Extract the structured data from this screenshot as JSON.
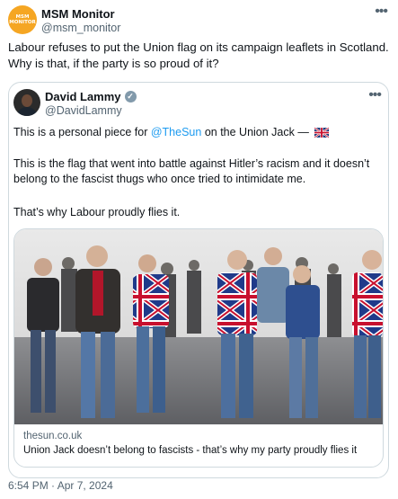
{
  "tweet": {
    "avatar_text": [
      "MSM",
      "MONITOR"
    ],
    "display_name": "MSM Monitor",
    "handle": "@msm_monitor",
    "more_icon": "more-horizontal-icon",
    "text": "Labour refuses to put the Union flag on its campaign leaflets in Scotland. Why is that, if the party is so proud of it?",
    "timestamp": "6:54 PM · Apr 7, 2024"
  },
  "quoted": {
    "display_name": "David Lammy",
    "handle": "@DavidLammy",
    "verified_icon": "verified-badge-icon",
    "line1_prefix": "This is a personal piece for ",
    "line1_mention": "@TheSun",
    "line1_suffix": " on the Union Jack —",
    "line2": "This is the flag that went into battle against Hitler’s racism and it doesn’t belong to the fascist thugs who once tried to intimidate me.",
    "line3": "That’s why Labour proudly flies it.",
    "card": {
      "domain": "thesun.co.uk",
      "title": "Union Jack doesn’t belong to fascists - that’s why my party proudly flies it"
    }
  },
  "colors": {
    "accent": "#1d9bf0",
    "avatar_bg": "#f5a623",
    "secondary_text": "#536471",
    "border": "#cfd9de"
  }
}
